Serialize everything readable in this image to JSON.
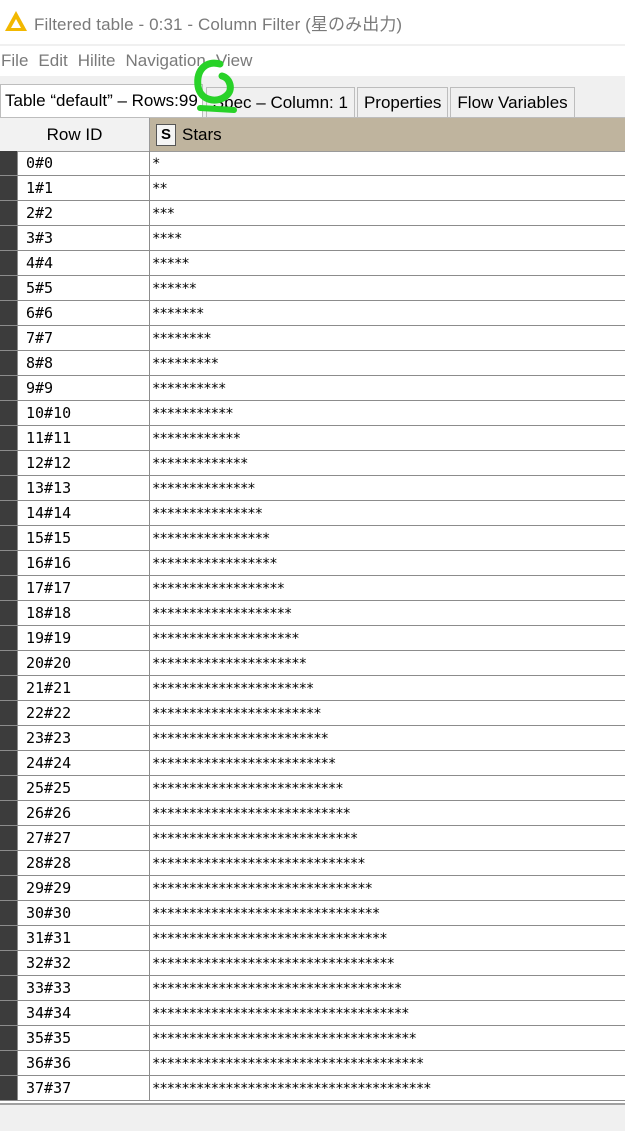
{
  "window": {
    "title": "Filtered table - 0:31 - Column Filter (星のみ出力)",
    "icon": "knime-triangle-icon",
    "accent_color": "#f2b800"
  },
  "menu": [
    "File",
    "Edit",
    "Hilite",
    "Navigation",
    "View"
  ],
  "tabs": {
    "data_prefix": "Table “default” – Rows: ",
    "row_count": "99",
    "spec": "Spec – Column: 1",
    "properties": "Properties",
    "flow_variables": "Flow Variables"
  },
  "table": {
    "rowid_header": "Row ID",
    "column": {
      "type": "S",
      "name": "Stars",
      "header_color": "#bfb49e"
    },
    "rows": [
      {
        "id": "0#0",
        "stars": "*"
      },
      {
        "id": "1#1",
        "stars": "**"
      },
      {
        "id": "2#2",
        "stars": "***"
      },
      {
        "id": "3#3",
        "stars": "****"
      },
      {
        "id": "4#4",
        "stars": "*****"
      },
      {
        "id": "5#5",
        "stars": "******"
      },
      {
        "id": "6#6",
        "stars": "*******"
      },
      {
        "id": "7#7",
        "stars": "********"
      },
      {
        "id": "8#8",
        "stars": "*********"
      },
      {
        "id": "9#9",
        "stars": "**********"
      },
      {
        "id": "10#10",
        "stars": "***********"
      },
      {
        "id": "11#11",
        "stars": "************"
      },
      {
        "id": "12#12",
        "stars": "*************"
      },
      {
        "id": "13#13",
        "stars": "**************"
      },
      {
        "id": "14#14",
        "stars": "***************"
      },
      {
        "id": "15#15",
        "stars": "****************"
      },
      {
        "id": "16#16",
        "stars": "*****************"
      },
      {
        "id": "17#17",
        "stars": "******************"
      },
      {
        "id": "18#18",
        "stars": "*******************"
      },
      {
        "id": "19#19",
        "stars": "********************"
      },
      {
        "id": "20#20",
        "stars": "*********************"
      },
      {
        "id": "21#21",
        "stars": "**********************"
      },
      {
        "id": "22#22",
        "stars": "***********************"
      },
      {
        "id": "23#23",
        "stars": "************************"
      },
      {
        "id": "24#24",
        "stars": "*************************"
      },
      {
        "id": "25#25",
        "stars": "**************************"
      },
      {
        "id": "26#26",
        "stars": "***************************"
      },
      {
        "id": "27#27",
        "stars": "****************************"
      },
      {
        "id": "28#28",
        "stars": "*****************************"
      },
      {
        "id": "29#29",
        "stars": "******************************"
      },
      {
        "id": "30#30",
        "stars": "*******************************"
      },
      {
        "id": "31#31",
        "stars": "********************************"
      },
      {
        "id": "32#32",
        "stars": "*********************************"
      },
      {
        "id": "33#33",
        "stars": "**********************************"
      },
      {
        "id": "34#34",
        "stars": "***********************************"
      },
      {
        "id": "35#35",
        "stars": "************************************"
      },
      {
        "id": "36#36",
        "stars": "*************************************"
      },
      {
        "id": "37#37",
        "stars": "**************************************"
      }
    ]
  }
}
